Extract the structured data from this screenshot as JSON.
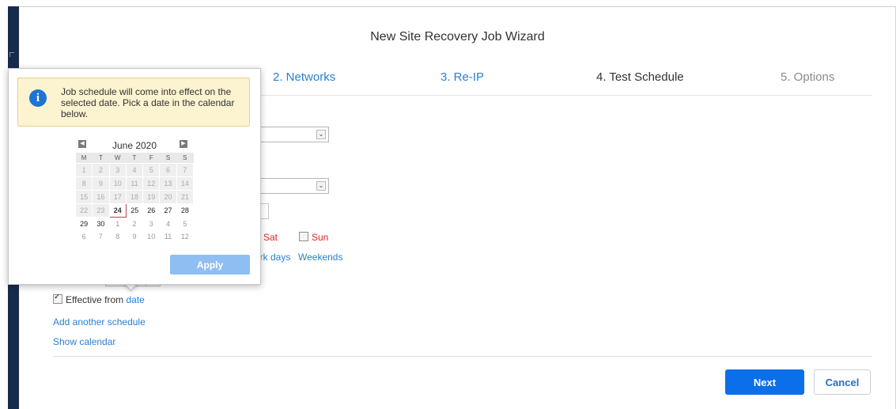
{
  "wizard": {
    "title": "New Site Recovery Job Wizard"
  },
  "steps": [
    {
      "label": "2. Networks",
      "state": "done"
    },
    {
      "label": "3. Re-IP",
      "state": "done"
    },
    {
      "label": "4. Test Schedule",
      "state": "active"
    },
    {
      "label": "5. Options",
      "state": "future"
    }
  ],
  "schedule": {
    "days": [
      "Sat",
      "Sun"
    ],
    "quick_select": [
      "ork days",
      "Weekends"
    ],
    "effective_label": "Effective from",
    "effective_link": "date",
    "effective_checked": true,
    "add_schedule": "Add another schedule",
    "show_calendar": "Show calendar"
  },
  "popup": {
    "info": "Job schedule will come into effect on the selected date. Pick a date in the calendar below.",
    "calendar": {
      "month": "June 2020",
      "weekdays": [
        "M",
        "T",
        "W",
        "T",
        "F",
        "S",
        "S"
      ],
      "weeks": [
        [
          "1",
          "2",
          "3",
          "4",
          "5",
          "6",
          "7"
        ],
        [
          "8",
          "9",
          "10",
          "11",
          "12",
          "13",
          "14"
        ],
        [
          "15",
          "16",
          "17",
          "18",
          "19",
          "20",
          "21"
        ],
        [
          "22",
          "23",
          "24",
          "25",
          "26",
          "27",
          "28"
        ],
        [
          "29",
          "30",
          "1",
          "2",
          "3",
          "4",
          "5"
        ],
        [
          "6",
          "7",
          "8",
          "9",
          "10",
          "11",
          "12"
        ]
      ],
      "selected": "24"
    },
    "apply": "Apply"
  },
  "buttons": {
    "next": "Next",
    "cancel": "Cancel"
  },
  "colors": {
    "primary": "#0a6fe8",
    "link": "#2a7fd4",
    "weekend": "#d62828",
    "sidebar": "#172b4d"
  }
}
